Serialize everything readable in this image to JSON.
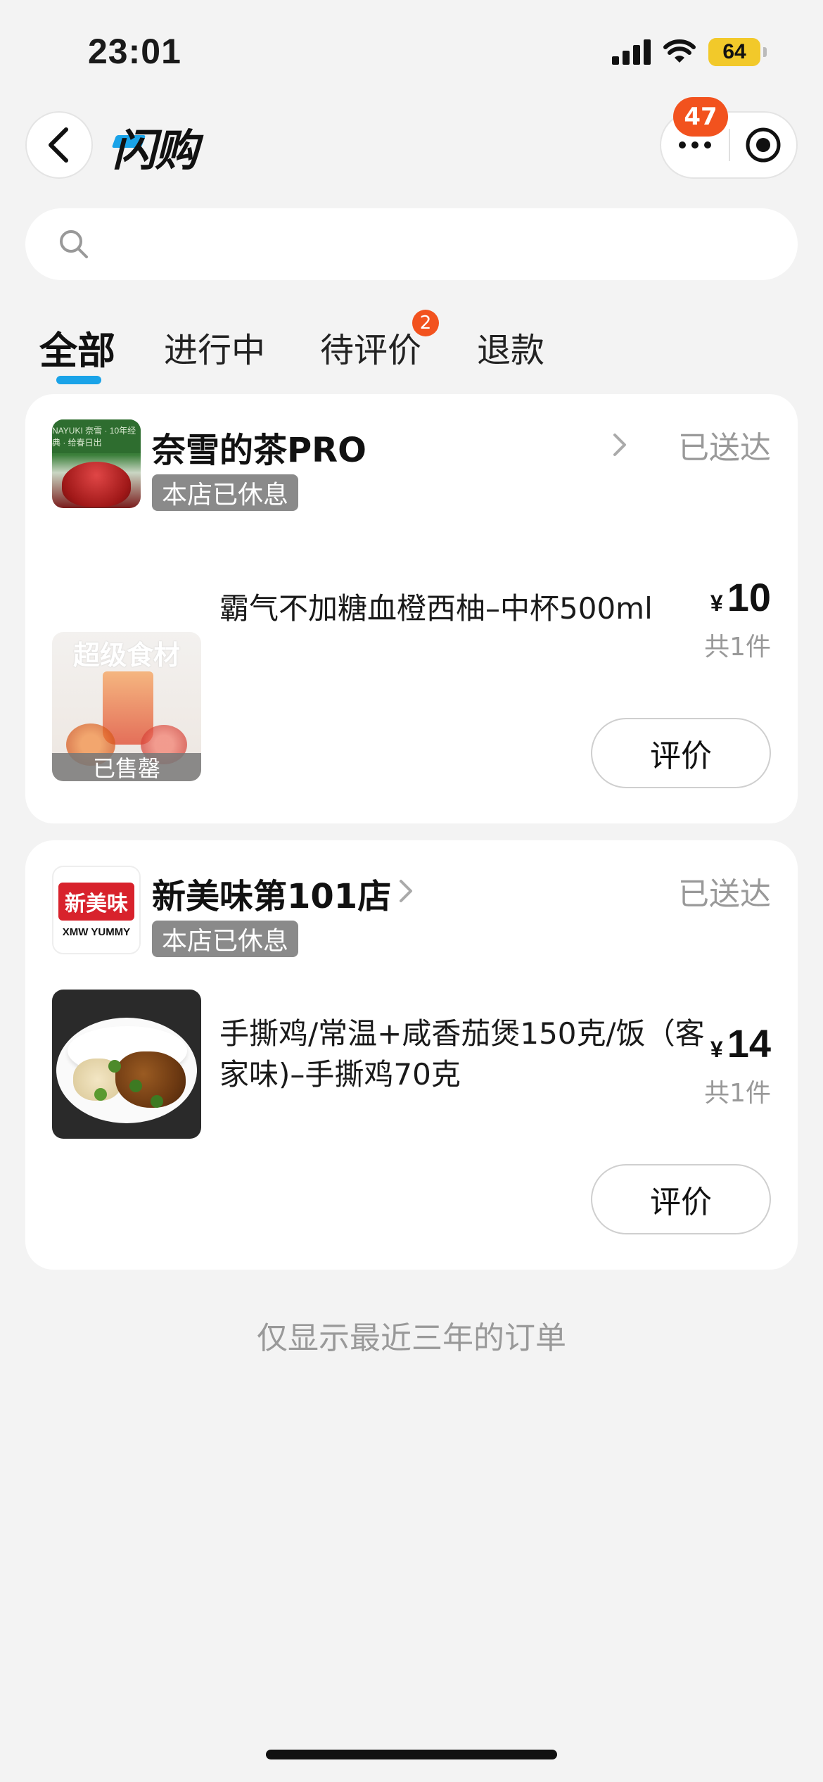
{
  "status_bar": {
    "time": "23:01",
    "battery": "64"
  },
  "nav": {
    "brand": "闪购",
    "notification_count": "47"
  },
  "search": {
    "placeholder": ""
  },
  "tabs": [
    {
      "label": "全部",
      "active": true
    },
    {
      "label": "进行中"
    },
    {
      "label": "待评价",
      "badge": "2"
    },
    {
      "label": "退款"
    }
  ],
  "orders": [
    {
      "shop_name": "奈雪的茶PRO",
      "status": "已送达",
      "rest_badge": "本店已休息",
      "logo_text": "NAYUKI 奈雪 · 10年经典 · 给春日出",
      "product": {
        "name": "霸气不加糖血橙西柚–中杯500ml",
        "image_caption": "超级食材",
        "soldout": "已售罄"
      },
      "price_symbol": "¥",
      "price": "10",
      "quantity": "共1件",
      "review_label": "评价"
    },
    {
      "shop_name": "新美味第101店",
      "status": "已送达",
      "rest_badge": "本店已休息",
      "logo_mark": "新美味",
      "logo_sub": "XMW YUMMY",
      "product": {
        "name": "手撕鸡/常温+咸香茄煲150克/饭（客家味)–手撕鸡70克"
      },
      "price_symbol": "¥",
      "price": "14",
      "quantity": "共1件",
      "review_label": "评价"
    }
  ],
  "footer_note": "仅显示最近三年的订单",
  "colors": {
    "accent": "#1aa3e8",
    "badge": "#f2521e",
    "background": "#f3f3f3"
  }
}
